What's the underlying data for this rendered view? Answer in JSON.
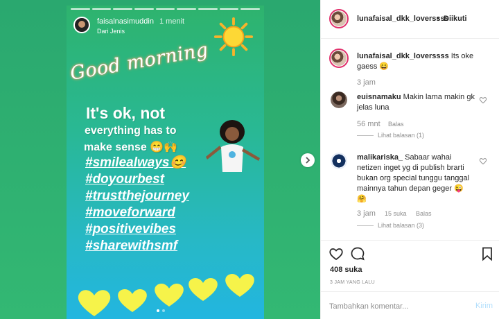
{
  "story": {
    "username": "faisalnasimuddin",
    "time": "1 menit",
    "source": "Dari Jenis",
    "greeting": "Good morning",
    "message_line1": "It's ok, not",
    "message_line2": "everything has to",
    "message_line3": "make sense 😁🙌",
    "hashtags": [
      "#smilealways😊",
      "#doyourbest",
      "#trustthejourney",
      "#moveforward",
      "#positivevibes",
      "#sharewithsmf"
    ],
    "page_count": 2,
    "active_page": 1
  },
  "post": {
    "username": "lunafaisal_dkk_loverssss",
    "dot": "•",
    "follow_label": "Diikuti",
    "caption_text": "Its oke gaess 😄",
    "caption_time": "3 jam",
    "likes": "408 suka",
    "posted_ago": "3 JAM YANG LALU"
  },
  "comments": [
    {
      "username": "euisnamaku",
      "text": "Makin lama makin gk jelas luna",
      "time": "56 mnt",
      "reply_label": "Balas",
      "view_replies": "Lihat balasan (1)"
    },
    {
      "username": "malikariska_",
      "text": "Sabaar wahai netizen inget yg di publish brarti bukan org special tunggu tanggal mainnya tahun depan geger 😜 🤗",
      "time": "3 jam",
      "likes": "15 suka",
      "reply_label": "Balas",
      "view_replies": "Lihat balasan (3)"
    }
  ],
  "add_comment": {
    "placeholder": "Tambahkan komentar...",
    "post_label": "Kirim"
  },
  "colors": {
    "link": "#262626",
    "muted": "#8e8e8e",
    "post_button": "#b2dffc",
    "story_ring": "#e1306c"
  },
  "icons": [
    "chevron-right-icon",
    "heart-icon",
    "comment-icon",
    "bookmark-icon",
    "sun-icon"
  ]
}
